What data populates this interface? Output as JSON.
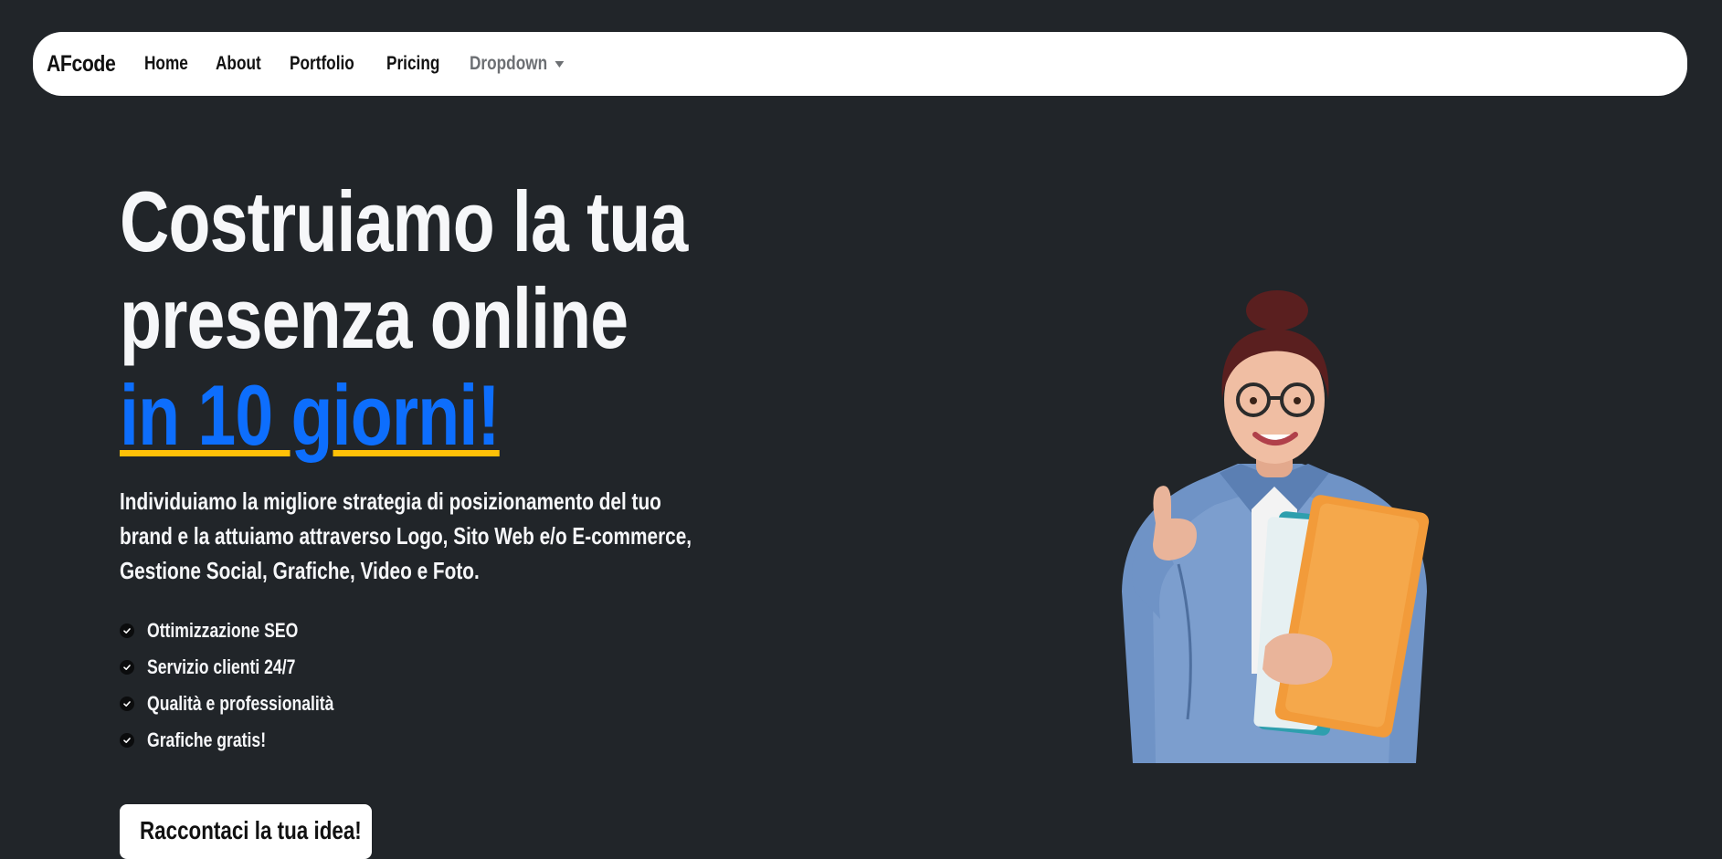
{
  "navbar": {
    "brand": "AFcode",
    "links": [
      {
        "label": "Home"
      },
      {
        "label": "About"
      },
      {
        "label": "Portfolio"
      },
      {
        "label": "Pricing"
      }
    ],
    "dropdown_label": "Dropdown"
  },
  "hero": {
    "title_line1": "Costruiamo la tua",
    "title_line2": "presenza online",
    "title_accent": "in 10 giorni!",
    "lead": "Individuiamo la migliore strategia di posizionamento del tuo brand e la attuiamo attraverso Logo, Sito Web e/o E-commerce, Gestione Social, Grafiche, Video e Foto.",
    "features": [
      {
        "label": "Ottimizzazione SEO",
        "icon": "check-circle-icon"
      },
      {
        "label": "Servizio clienti 24/7",
        "icon": "check-circle-icon"
      },
      {
        "label": "Qualità e professionalità",
        "icon": "check-circle-icon"
      },
      {
        "label": "Grafiche gratis!",
        "icon": "check-circle-icon"
      }
    ],
    "cta_label": "Raccontaci la tua idea!"
  },
  "colors": {
    "background": "#212529",
    "accent": "#0d6efd",
    "underline": "#ffc107",
    "navbar_bg": "#ffffff"
  }
}
